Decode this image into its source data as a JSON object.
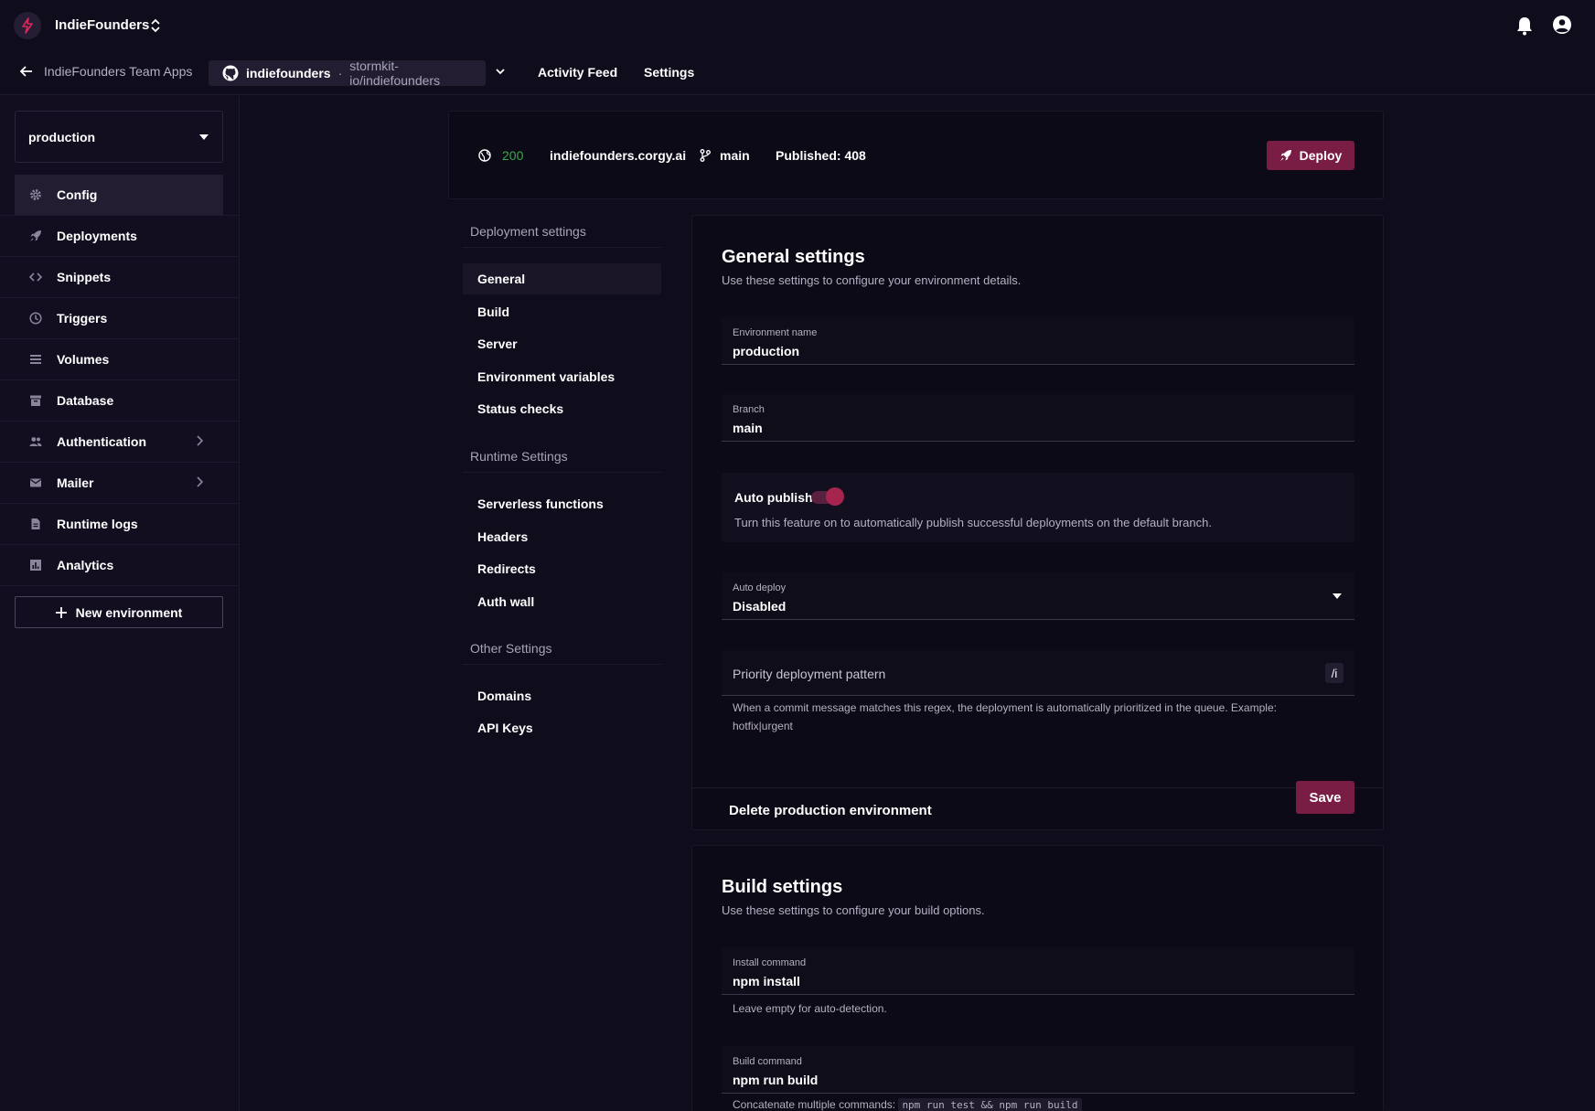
{
  "header": {
    "team_name": "IndieFounders",
    "back_label": "IndieFounders Team Apps",
    "repo_name": "indiefounders",
    "repo_separator": "·",
    "repo_path": "stormkit-io/indiefounders",
    "nav": [
      "Activity Feed",
      "Settings"
    ]
  },
  "sidebar": {
    "environment": "production",
    "items": [
      {
        "label": "Config",
        "icon": "gear-icon"
      },
      {
        "label": "Deployments",
        "icon": "rocket-icon"
      },
      {
        "label": "Snippets",
        "icon": "code-icon"
      },
      {
        "label": "Triggers",
        "icon": "clock-icon"
      },
      {
        "label": "Volumes",
        "icon": "list-icon"
      },
      {
        "label": "Database",
        "icon": "archive-icon"
      },
      {
        "label": "Authentication",
        "icon": "people-icon"
      },
      {
        "label": "Mailer",
        "icon": "mail-icon"
      },
      {
        "label": "Runtime logs",
        "icon": "document-icon"
      },
      {
        "label": "Analytics",
        "icon": "chart-icon"
      }
    ],
    "new_env_label": "New environment"
  },
  "status": {
    "code": "200",
    "domain": "indiefounders.corgy.ai",
    "branch": "main",
    "published": "Published: 408",
    "deploy_label": "Deploy"
  },
  "settings_nav": {
    "deployment_heading": "Deployment settings",
    "deployment_items": [
      "General",
      "Build",
      "Server",
      "Environment variables",
      "Status checks"
    ],
    "runtime_heading": "Runtime Settings",
    "runtime_items": [
      "Serverless functions",
      "Headers",
      "Redirects",
      "Auth wall"
    ],
    "other_heading": "Other Settings",
    "other_items": [
      "Domains",
      "API Keys"
    ]
  },
  "general": {
    "title": "General settings",
    "subtitle": "Use these settings to configure your environment details.",
    "env_name_label": "Environment name",
    "env_name_value": "production",
    "branch_label": "Branch",
    "branch_value": "main",
    "auto_publish_label": "Auto publish",
    "auto_publish_on": true,
    "auto_publish_help": "Turn this feature on to automatically publish successful deployments on the default branch.",
    "auto_deploy_label": "Auto deploy",
    "auto_deploy_value": "Disabled",
    "priority_placeholder": "Priority deployment pattern",
    "priority_suffix": "/i",
    "priority_help_1": "When a commit message matches this regex, the deployment is automatically prioritized in the queue. Example:",
    "priority_help_2": "hotfix|urgent",
    "delete_label": "Delete production environment",
    "save_label": "Save"
  },
  "build": {
    "title": "Build settings",
    "subtitle": "Use these settings to configure your build options.",
    "install_label": "Install command",
    "install_value": "npm install",
    "install_help": "Leave empty for auto-detection.",
    "build_label": "Build command",
    "build_value": "npm run build",
    "build_help": "Concatenate multiple commands:",
    "build_help_code": "npm run test && npm run build"
  },
  "colors": {
    "accent": "#7a1d45",
    "status_ok": "#3aa84a",
    "background": "#0f0c1c"
  }
}
